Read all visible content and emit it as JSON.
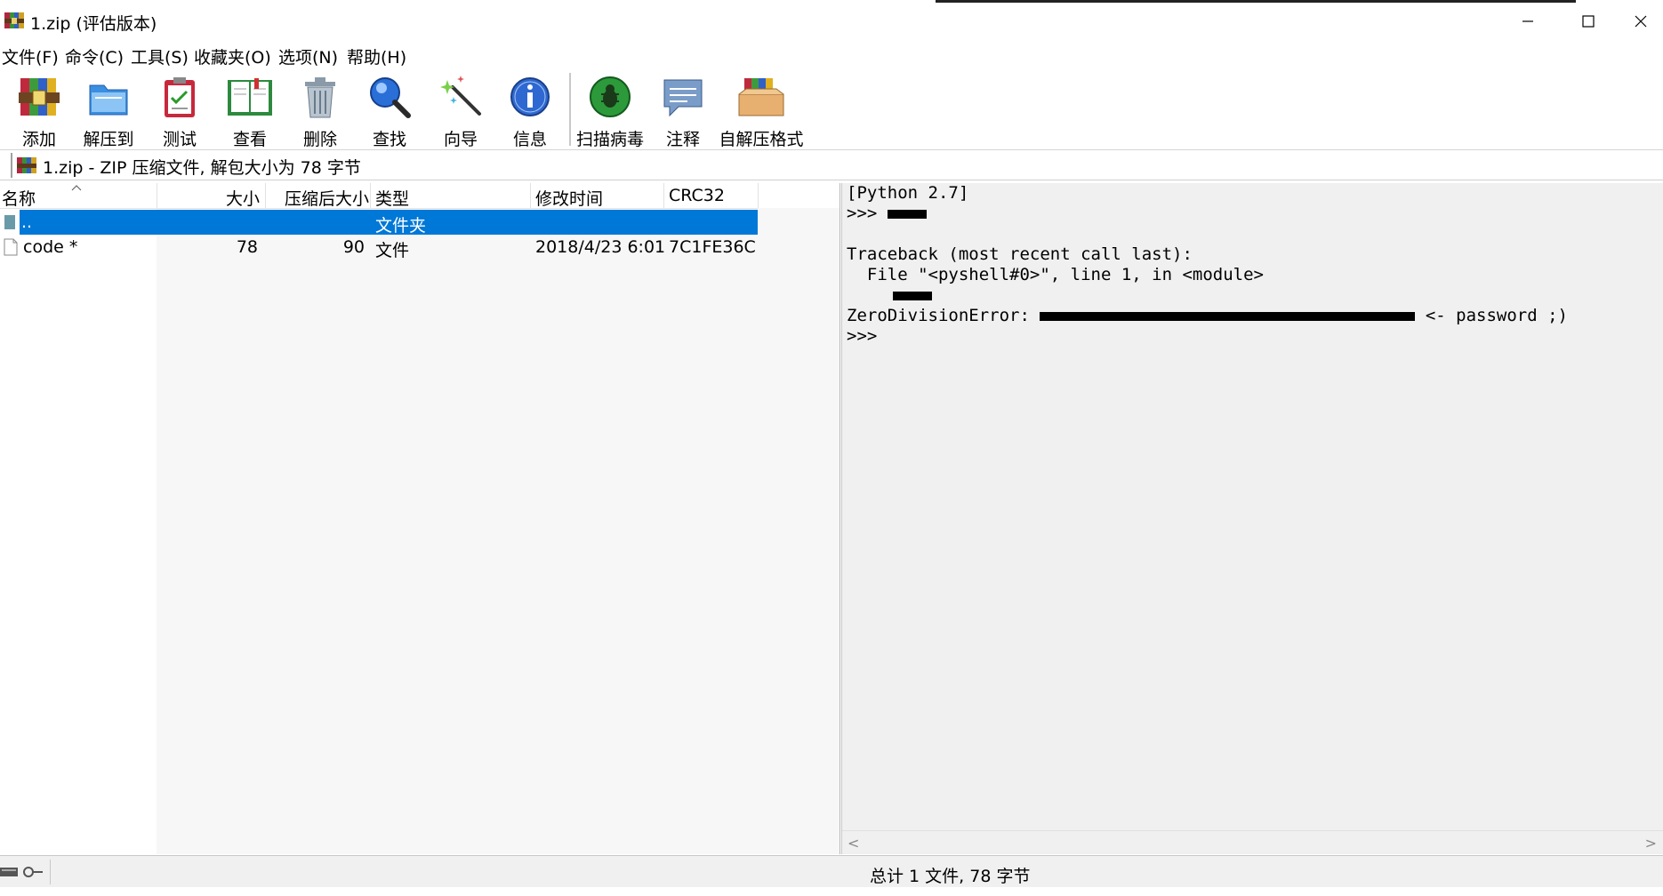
{
  "window": {
    "title": "1.zip (评估版本)"
  },
  "menu": [
    "文件(F)",
    "命令(C)",
    "工具(S)",
    "收藏夹(O)",
    "选项(N)",
    "帮助(H)"
  ],
  "toolbar": [
    {
      "label": "添加",
      "icon": "add-archive-icon"
    },
    {
      "label": "解压到",
      "icon": "extract-folder-icon"
    },
    {
      "label": "测试",
      "icon": "test-clipboard-icon"
    },
    {
      "label": "查看",
      "icon": "view-book-icon"
    },
    {
      "label": "删除",
      "icon": "trash-icon"
    },
    {
      "label": "查找",
      "icon": "magnifier-icon"
    },
    {
      "label": "向导",
      "icon": "wizard-wand-icon"
    },
    {
      "label": "信息",
      "icon": "info-icon"
    },
    {
      "label": "扫描病毒",
      "icon": "virus-scan-icon"
    },
    {
      "label": "注释",
      "icon": "comment-bubble-icon"
    },
    {
      "label": "自解压格式",
      "icon": "sfx-box-icon"
    }
  ],
  "address": {
    "text": "1.zip - ZIP 压缩文件, 解包大小为 78 字节"
  },
  "file_list": {
    "columns": [
      "名称",
      "大小",
      "压缩后大小",
      "类型",
      "修改时间",
      "CRC32"
    ],
    "rows": [
      {
        "name": "..",
        "size": "",
        "packed": "",
        "type": "文件夹",
        "modified": "",
        "crc": "",
        "selected": true
      },
      {
        "name": "code *",
        "size": "78",
        "packed": "90",
        "type": "文件",
        "modified": "2018/4/23 6:01",
        "crc": "7C1FE36C",
        "selected": false
      }
    ]
  },
  "shell": {
    "line1": "[Python 2.7]",
    "prompt": ">>>",
    "traceback": "Traceback (most recent call last):",
    "file_line": "  File \"<pyshell#0>\", line 1, in <module>",
    "error_label": "ZeroDivisionError:",
    "error_note": "<- password ;)",
    "prompt2": ">>>"
  },
  "status": {
    "text": "总计 1 文件, 78 字节"
  },
  "colors": {
    "selection": "#0078d7",
    "panel_bg": "#f0f0f0"
  }
}
